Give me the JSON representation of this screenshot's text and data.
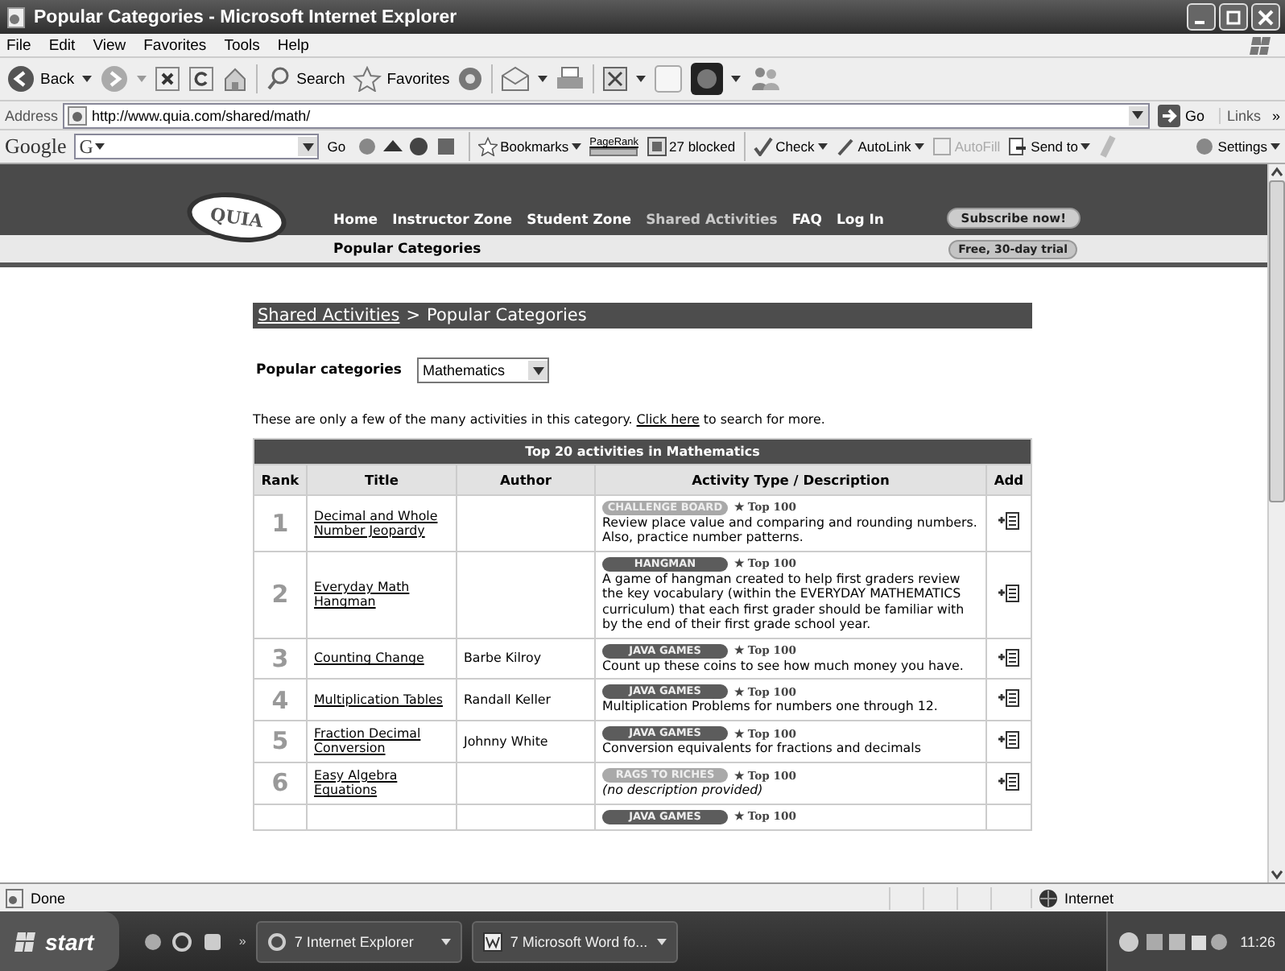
{
  "window": {
    "title": "Popular Categories - Microsoft Internet Explorer"
  },
  "menu": [
    "File",
    "Edit",
    "View",
    "Favorites",
    "Tools",
    "Help"
  ],
  "toolbar": {
    "back": "Back",
    "search": "Search",
    "favorites": "Favorites"
  },
  "address_bar": {
    "label": "Address",
    "url": "http://www.quia.com/shared/math/",
    "go": "Go",
    "links": "Links",
    "more": "»"
  },
  "google_bar": {
    "logo": "Google",
    "search_prefix": "G",
    "go": "Go",
    "bookmarks": "Bookmarks",
    "pagerank": "PageRank",
    "popups": "27 blocked",
    "check": "Check",
    "autolink": "AutoLink",
    "autofill": {
      "label": "AutoFill",
      "disabled": true
    },
    "send_to": "Send to",
    "settings": "Settings"
  },
  "site_header": {
    "logo": "QUIA",
    "nav": [
      {
        "label": "Home",
        "selected": false
      },
      {
        "label": "Instructor Zone",
        "selected": false
      },
      {
        "label": "Student Zone",
        "selected": false
      },
      {
        "label": "Shared Activities",
        "selected": true
      },
      {
        "label": "FAQ",
        "selected": false
      },
      {
        "label": "Log In",
        "selected": false
      }
    ],
    "subscribe": "Subscribe now!",
    "trial": "Free, 30-day trial",
    "section": "Popular Categories"
  },
  "breadcrumb": {
    "link": "Shared Activities",
    "separator": ">",
    "current": "Popular Categories"
  },
  "category_select": {
    "label": "Popular categories",
    "value": "Mathematics"
  },
  "intro": {
    "before": "These are only a few of the many activities in this category.",
    "link": "Click here",
    "after": "to search for more."
  },
  "table": {
    "title": "Top 20 activities in Mathematics",
    "columns": [
      "Rank",
      "Title",
      "Author",
      "Activity Type / Description",
      "Add"
    ],
    "rows": [
      {
        "rank": "1",
        "title": "Decimal and Whole Number Jeopardy",
        "badge": {
          "label": "CHALLENGE BOARD",
          "color": "#a9a9a9"
        },
        "top": "★ Top 100",
        "description": "Review place value and comparing and rounding numbers. Also, practice number patterns."
      },
      {
        "rank": "2",
        "title": "Everyday Math Hangman",
        "badge": {
          "label": "HANGMAN",
          "color": "#5c5c5c"
        },
        "top": "★ Top 100",
        "description": "A game of hangman created to help first graders review the key vocabulary (within the EVERYDAY MATHEMATICS curriculum) that each first grader should be familiar with by the end of their first grade school year."
      },
      {
        "rank": "3",
        "title": "Counting Change",
        "author": "Barbe Kilroy",
        "badge": {
          "label": "JAVA GAMES",
          "color": "#5c5c5c"
        },
        "top": "★ Top 100",
        "description": "Count up these coins to see how much money you have."
      },
      {
        "rank": "4",
        "title": "Multiplication Tables",
        "author": "Randall Keller",
        "badge": {
          "label": "JAVA GAMES",
          "color": "#5c5c5c"
        },
        "top": "★ Top 100",
        "description": "Multiplication Problems for numbers one through 12."
      },
      {
        "rank": "5",
        "title": "Fraction Decimal Conversion",
        "author": "Johnny White",
        "badge": {
          "label": "JAVA GAMES",
          "color": "#5c5c5c"
        },
        "top": "★ Top 100",
        "description": "Conversion equivalents for fractions and decimals"
      },
      {
        "rank": "6",
        "title": "Easy Algebra Equations",
        "badge": {
          "label": "RAGS TO RICHES",
          "color": "#a9a9a9"
        },
        "top": "★ Top 100",
        "description": "(no description provided)",
        "no_description": true
      },
      {
        "badge": {
          "label": "JAVA GAMES",
          "color": "#5c5c5c"
        },
        "top": "★ Top 100"
      }
    ]
  },
  "status_bar": {
    "text": "Done",
    "zone": "Internet"
  },
  "taskbar": {
    "start": "start",
    "more": "»",
    "tasks": [
      "7 Internet Explorer",
      "7 Microsoft Word fo..."
    ],
    "clock": "11:26"
  }
}
